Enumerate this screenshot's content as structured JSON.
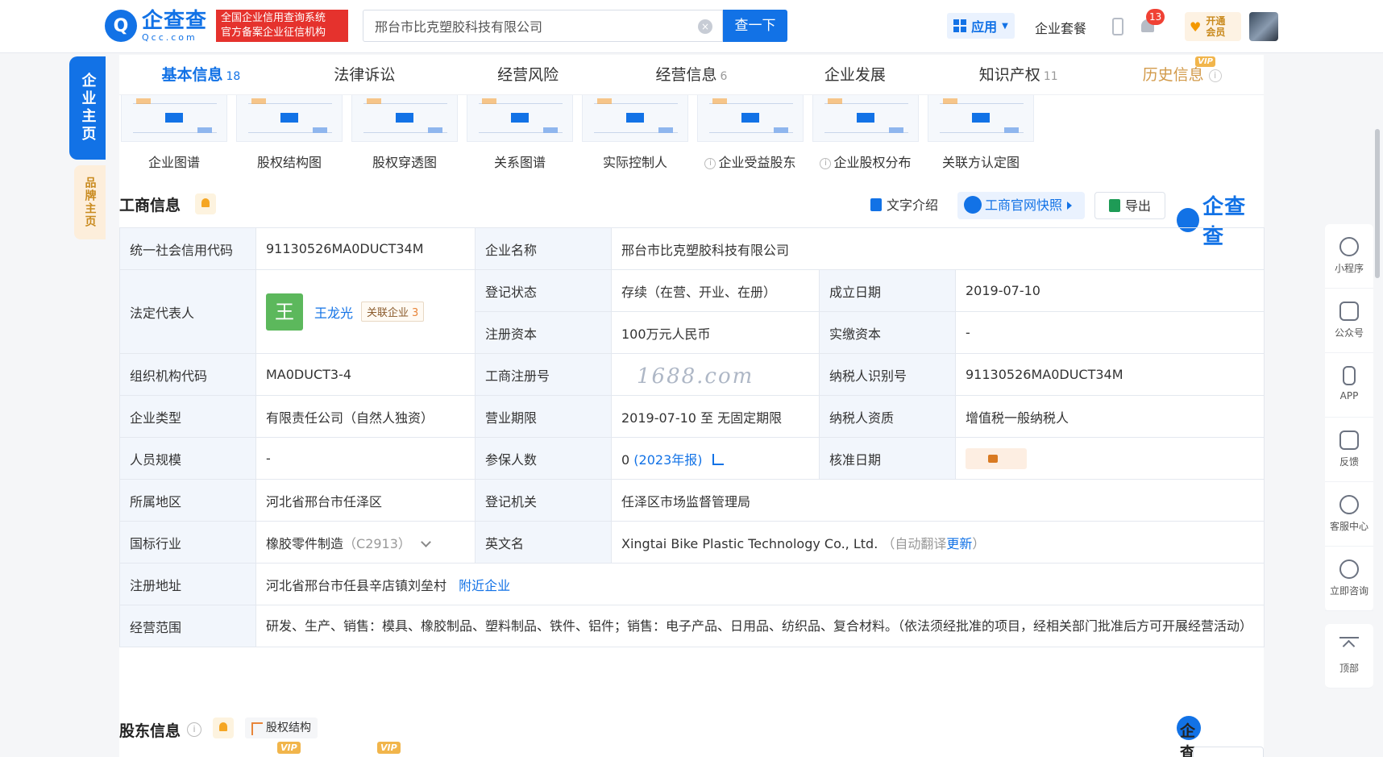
{
  "header": {
    "logo_cn": "企查查",
    "logo_en": "Qcc.com",
    "slogan_line1": "全国企业信用查询系统",
    "slogan_line2": "官方备案企业征信机构",
    "search_value": "邢台市比克塑胶科技有限公司",
    "search_button": "查一下",
    "apps_label": "应用",
    "suite_label": "企业套餐",
    "notification_count": "13",
    "vip_label": "开通会员"
  },
  "side_tabs": {
    "main": "企业主页",
    "brand": "品牌主页"
  },
  "main_tabs": [
    {
      "label": "基本信息",
      "count": "18"
    },
    {
      "label": "法律诉讼",
      "count": ""
    },
    {
      "label": "经营风险",
      "count": ""
    },
    {
      "label": "经营信息",
      "count": "6"
    },
    {
      "label": "企业发展",
      "count": ""
    },
    {
      "label": "知识产权",
      "count": "11"
    },
    {
      "label": "历史信息",
      "count": "",
      "tag": "VIP"
    }
  ],
  "graphs": [
    {
      "label": "企业图谱",
      "info": false
    },
    {
      "label": "股权结构图",
      "info": false
    },
    {
      "label": "股权穿透图",
      "info": false
    },
    {
      "label": "关系图谱",
      "info": false
    },
    {
      "label": "实际控制人",
      "info": false
    },
    {
      "label": "企业受益股东",
      "info": true
    },
    {
      "label": "企业股权分布",
      "info": true
    },
    {
      "label": "关联方认定图",
      "info": false
    }
  ],
  "section": {
    "title": "工商信息",
    "text_intro": "文字介绍",
    "snapshot": "工商官网快照",
    "export": "导出",
    "brand": "企查查"
  },
  "company": {
    "credit_code_k": "统一社会信用代码",
    "credit_code": "91130526MA0DUCT34M",
    "name_k": "企业名称",
    "name": "邢台市比克塑胶科技有限公司",
    "legal_rep_k": "法定代表人",
    "legal_rep_avatar": "王",
    "legal_rep": "王龙光",
    "related_label": "关联企业",
    "related_count": "3",
    "status_k": "登记状态",
    "status": "存续（在营、开业、在册）",
    "founded_k": "成立日期",
    "founded": "2019-07-10",
    "reg_capital_k": "注册资本",
    "reg_capital": "100万元人民币",
    "paid_capital_k": "实缴资本",
    "paid_capital": "-",
    "org_code_k": "组织机构代码",
    "org_code": "MA0DUCT3-4",
    "reg_no_k": "工商注册号",
    "reg_no": "",
    "taxpayer_id_k": "纳税人识别号",
    "taxpayer_id": "91130526MA0DUCT34M",
    "type_k": "企业类型",
    "type": "有限责任公司（自然人独资）",
    "term_k": "营业期限",
    "term": "2019-07-10 至 无固定期限",
    "taxpayer_q_k": "纳税人资质",
    "taxpayer_q": "增值税一般纳税人",
    "staff_k": "人员规模",
    "staff": "-",
    "insured_k": "参保人数",
    "insured": "0",
    "insured_report": "(2023年报)",
    "approval_k": "核准日期",
    "region_k": "所属地区",
    "region": "河北省邢台市任泽区",
    "authority_k": "登记机关",
    "authority": "任泽区市场监督管理局",
    "industry_k": "国标行业",
    "industry": "橡胶零件制造",
    "industry_code": "（C2913）",
    "en_name_k": "英文名",
    "en_name": "Xingtai Bike Plastic Technology Co., Ltd.",
    "en_auto": "（自动翻译",
    "en_update": "更新",
    "en_close": "）",
    "address_k": "注册地址",
    "address": "河北省邢台市任县辛店镇刘垒村",
    "nearby": "附近企业",
    "scope_k": "经营范围",
    "scope": "研发、生产、销售：模具、橡胶制品、塑料制品、铁件、铝件；销售：电子产品、日用品、纺织品、复合材料。（依法须经批准的项目，经相关部门批准后方可开展经营活动）"
  },
  "watermark": "1688.com",
  "shareholders": {
    "title": "股东信息",
    "structure": "股权结构",
    "vip": "VIP"
  },
  "right_bar": [
    {
      "label": "小程序",
      "icon": "link-icon"
    },
    {
      "label": "公众号",
      "icon": "scan-icon"
    },
    {
      "label": "APP",
      "icon": "phone-icon"
    },
    {
      "label": "反馈",
      "icon": "feedback-icon"
    },
    {
      "label": "客服中心",
      "icon": "headset-icon"
    },
    {
      "label": "立即咨询",
      "icon": "chat-icon"
    }
  ],
  "top_label": "顶部"
}
